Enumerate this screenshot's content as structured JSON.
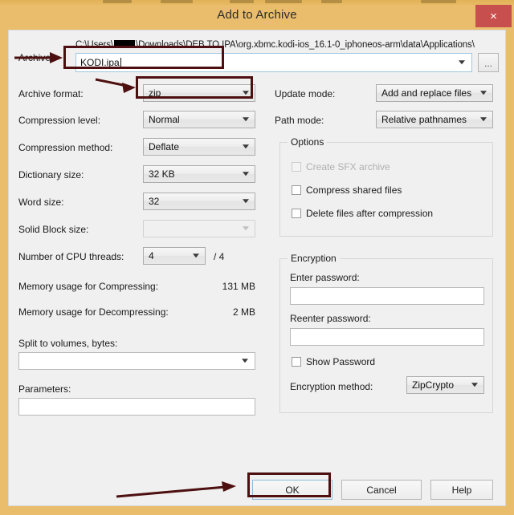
{
  "window": {
    "title": "Add to Archive",
    "close_label": "×",
    "frame_color": "#e9bd6c",
    "close_color": "#c7504f",
    "annotation_color": "#4d0f0f"
  },
  "archive": {
    "label": "Archive:",
    "path_prefix": "C:\\Users\\",
    "path_suffix": "\\Downloads\\DEB TO IPA\\org.xbmc.kodi-ios_16.1-0_iphoneos-arm\\data\\Applications\\",
    "filename_value": "KODI.ipa",
    "browse_label": "...",
    "dropdown_icon": "chevron-down-icon"
  },
  "left": {
    "archive_format": {
      "label": "Archive format:",
      "value": "zip"
    },
    "compression_level": {
      "label": "Compression level:",
      "value": "Normal"
    },
    "compression_method": {
      "label": "Compression method:",
      "value": "Deflate"
    },
    "dictionary_size": {
      "label": "Dictionary size:",
      "value": "32 KB"
    },
    "word_size": {
      "label": "Word size:",
      "value": "32"
    },
    "solid_block_size": {
      "label": "Solid Block size:",
      "value": ""
    },
    "cpu_threads": {
      "label": "Number of CPU threads:",
      "value": "4",
      "total": "/ 4"
    },
    "mem_compress": {
      "label": "Memory usage for Compressing:",
      "value": "131 MB"
    },
    "mem_decompress": {
      "label": "Memory usage for Decompressing:",
      "value": "2 MB"
    },
    "split_volumes": {
      "label": "Split to volumes, bytes:",
      "value": ""
    },
    "parameters": {
      "label": "Parameters:",
      "value": ""
    }
  },
  "right": {
    "update_mode": {
      "label": "Update mode:",
      "value": "Add and replace files"
    },
    "path_mode": {
      "label": "Path mode:",
      "value": "Relative pathnames"
    },
    "options": {
      "title": "Options",
      "items": [
        {
          "label": "Create SFX archive",
          "checked": false,
          "disabled": true
        },
        {
          "label": "Compress shared files",
          "checked": false,
          "disabled": false
        },
        {
          "label": "Delete files after compression",
          "checked": false,
          "disabled": false
        }
      ]
    },
    "encryption": {
      "title": "Encryption",
      "enter_password_label": "Enter password:",
      "enter_password_value": "",
      "reenter_password_label": "Reenter password:",
      "reenter_password_value": "",
      "show_password_label": "Show Password",
      "show_password_checked": false,
      "method_label": "Encryption method:",
      "method_value": "ZipCrypto"
    }
  },
  "buttons": {
    "ok": "OK",
    "cancel": "Cancel",
    "help": "Help"
  }
}
